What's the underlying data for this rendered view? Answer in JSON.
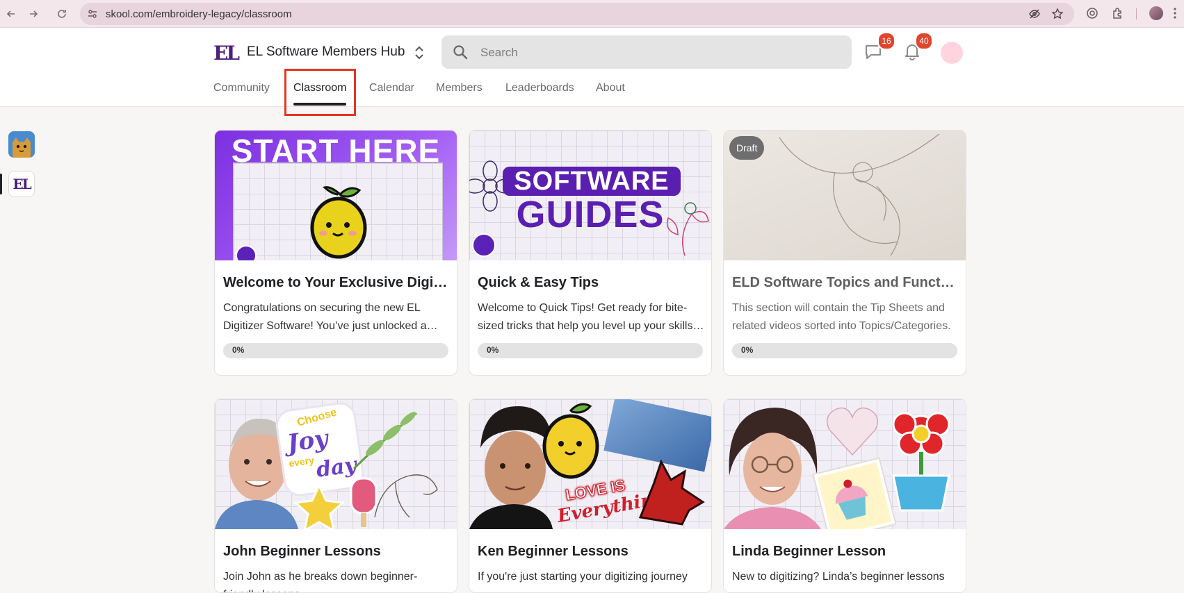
{
  "browser": {
    "url": "skool.com/embroidery-legacy/classroom"
  },
  "header": {
    "logo_text": "EL",
    "hub_name": "EL Software Members Hub",
    "search_placeholder": "Search",
    "chat_badge": "16",
    "notification_badge": "40"
  },
  "tabs": [
    {
      "label": "Community"
    },
    {
      "label": "Classroom"
    },
    {
      "label": "Calendar"
    },
    {
      "label": "Members"
    },
    {
      "label": "Leaderboards"
    },
    {
      "label": "About"
    }
  ],
  "active_tab": "Classroom",
  "rail": {
    "el_logo_text": "EL"
  },
  "courses": [
    {
      "title": "Welcome to Your Exclusive Digitizer Software Journey",
      "description": "Congratulations on securing the new EL Digitizer Software! You’ve just unlocked a world of creative possibilities.",
      "progress_label": "0%",
      "progress": 0,
      "thumb_text": "START HERE",
      "draft": false
    },
    {
      "title": "Quick & Easy Tips",
      "description": "Welcome to Quick Tips! Get ready for bite-sized tricks that help you level up your skills fast.",
      "progress_label": "0%",
      "progress": 0,
      "thumb_text_1": "SOFTWARE",
      "thumb_text_2": "GUIDES",
      "draft": false
    },
    {
      "title": "ELD Software Topics and Functions",
      "description": "This section will contain the Tip Sheets and related videos sorted into Topics/Categories.",
      "progress_label": "0%",
      "progress": 0,
      "draft": true,
      "draft_label": "Draft"
    },
    {
      "title": "John Beginner Lessons",
      "description": "Join John as he breaks down beginner-friendly lessons.",
      "thumb_text_1": "Choose",
      "thumb_text_2": "Joy",
      "thumb_text_3": "every",
      "thumb_text_4": "day"
    },
    {
      "title": "Ken Beginner Lessons",
      "description": "If you're just starting your digitizing journey",
      "thumb_text_1": "LOVE IS",
      "thumb_text_2": "Everything"
    },
    {
      "title": "Linda Beginner Lesson",
      "description": "New to digitizing? Linda’s beginner lessons"
    }
  ],
  "colors": {
    "accent": "#e2371f",
    "badge": "#e0452e",
    "brand": "#4b1f7a"
  }
}
